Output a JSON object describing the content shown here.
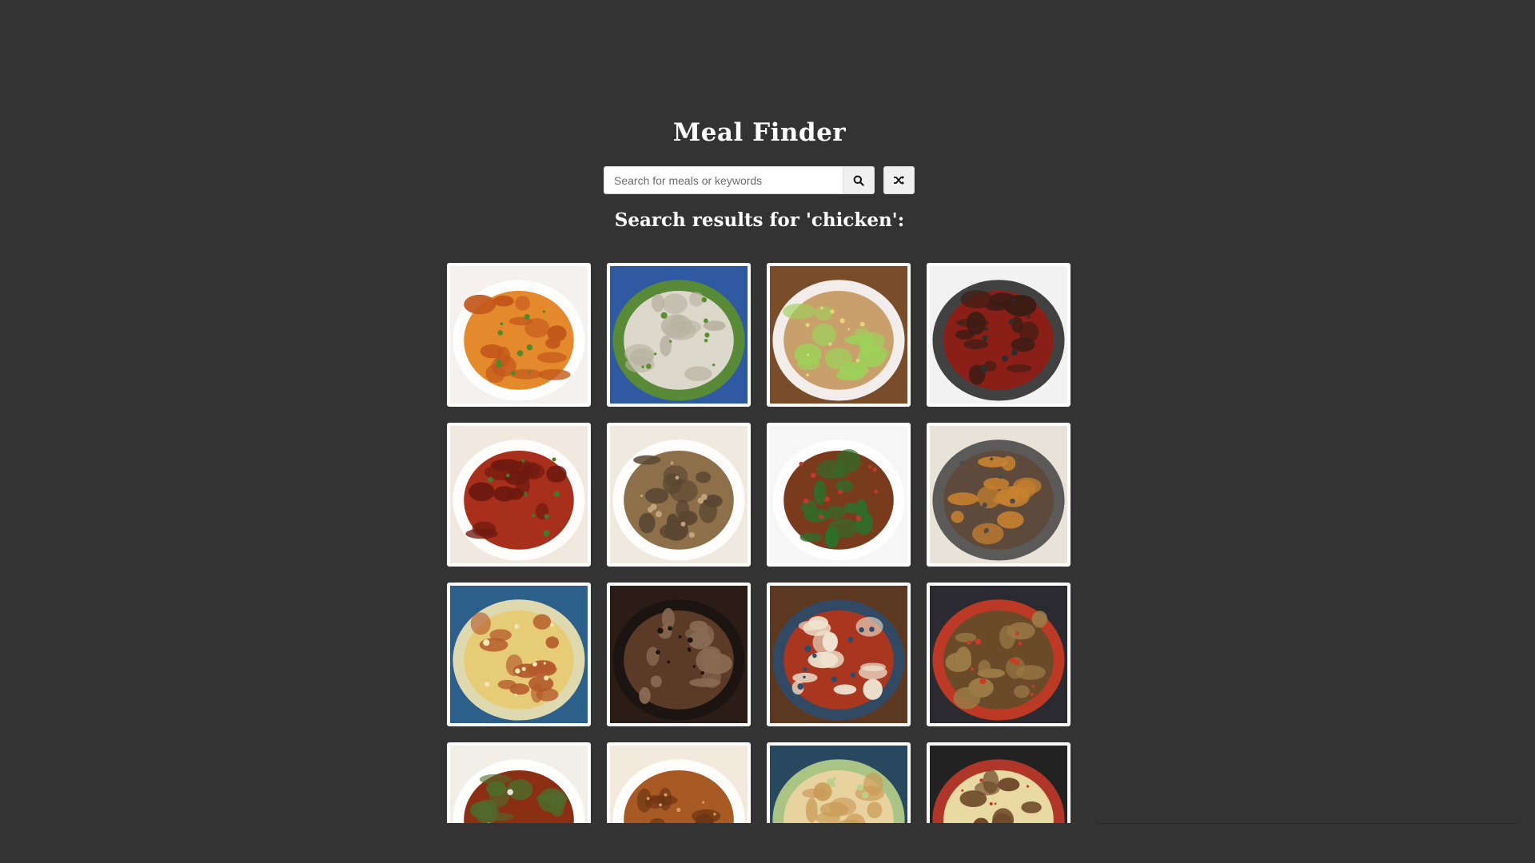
{
  "app": {
    "title": "Meal Finder"
  },
  "search": {
    "placeholder": "Search for meals or keywords",
    "value": "",
    "search_icon": "search-icon",
    "random_icon": "shuffle-icon"
  },
  "results": {
    "heading": "Search results for 'chicken':",
    "meals": [
      {
        "style": "tandoori",
        "colors": [
          "#f4f1ee",
          "#e58a2c",
          "#c2571b",
          "#4f8a2a"
        ]
      },
      {
        "style": "congee",
        "colors": [
          "#2f5aa1",
          "#dcd8cc",
          "#b9b3a2",
          "#5d8f2c"
        ]
      },
      {
        "style": "sandwich",
        "colors": [
          "#7a4d2a",
          "#c9a06c",
          "#9ed05a",
          "#e3d77a"
        ]
      },
      {
        "style": "pot",
        "colors": [
          "#f2f2f2",
          "#8a1f17",
          "#3b1c14",
          "#2d2d2d"
        ]
      },
      {
        "style": "drumsticks",
        "colors": [
          "#f1e9df",
          "#a82f1b",
          "#6e1a0f",
          "#46782c"
        ]
      },
      {
        "style": "risotto",
        "colors": [
          "#efe9e0",
          "#8d6f4a",
          "#5a4632",
          "#c3a27a"
        ]
      },
      {
        "style": "stirfry",
        "colors": [
          "#f6f6f6",
          "#7a3b1c",
          "#2f6d2b",
          "#c0392b"
        ]
      },
      {
        "style": "casserole",
        "colors": [
          "#e8e2d8",
          "#5d4a3c",
          "#c8812f",
          "#4b4b4b"
        ]
      },
      {
        "style": "pie",
        "colors": [
          "#2c5f8a",
          "#e6cc77",
          "#b45a2a",
          "#f3e7b4"
        ]
      },
      {
        "style": "stew",
        "colors": [
          "#2b1c15",
          "#5b3a28",
          "#8a6a52",
          "#1a1411"
        ]
      },
      {
        "style": "teriyaki",
        "colors": [
          "#5d3820",
          "#a9361f",
          "#efe4d0",
          "#2d4b6b"
        ]
      },
      {
        "style": "wok",
        "colors": [
          "#2a2a30",
          "#6b4a2a",
          "#9b7a45",
          "#cc3b25"
        ]
      },
      {
        "style": "glazed",
        "colors": [
          "#f2efe9",
          "#8b2f14",
          "#4f6a2a",
          "#e8e3d7"
        ]
      },
      {
        "style": "fried",
        "colors": [
          "#f3e9dc",
          "#a85a25",
          "#6c3413",
          "#d79c5a"
        ]
      },
      {
        "style": "potpie",
        "colors": [
          "#27485e",
          "#e8d3a0",
          "#c99a55",
          "#b9d18a"
        ]
      },
      {
        "style": "pasta",
        "colors": [
          "#222222",
          "#e8d9a3",
          "#6b4728",
          "#c0392b"
        ]
      }
    ]
  }
}
